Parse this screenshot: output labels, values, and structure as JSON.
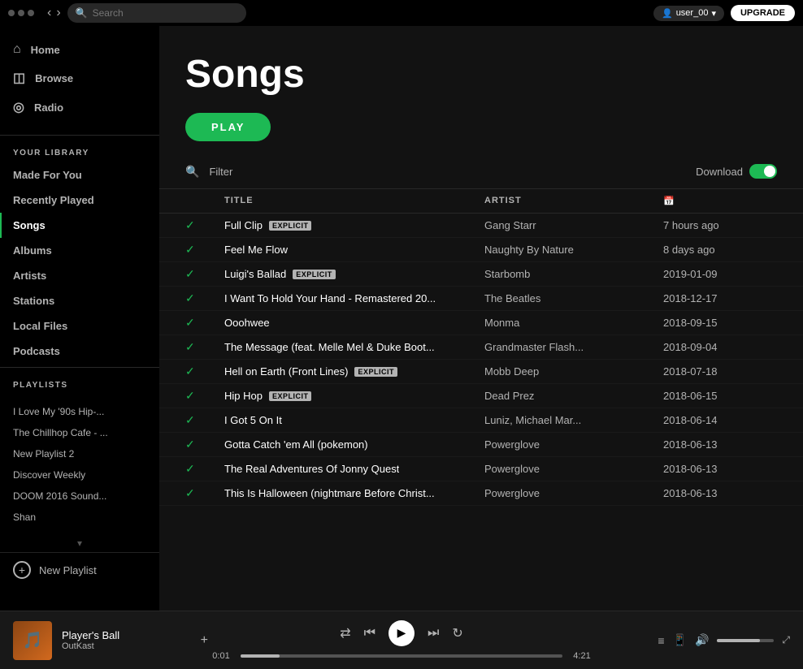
{
  "topbar": {
    "search_placeholder": "Search",
    "username": "user_00",
    "upgrade_label": "UPGRADE"
  },
  "sidebar": {
    "nav_items": [
      {
        "id": "home",
        "label": "Home",
        "icon": "⌂"
      },
      {
        "id": "browse",
        "label": "Browse",
        "icon": "◫"
      },
      {
        "id": "radio",
        "label": "Radio",
        "icon": "◎"
      }
    ],
    "library_title": "YOUR LIBRARY",
    "library_items": [
      {
        "id": "made-for-you",
        "label": "Made For You"
      },
      {
        "id": "recently-played",
        "label": "Recently Played"
      },
      {
        "id": "songs",
        "label": "Songs",
        "active": true
      },
      {
        "id": "albums",
        "label": "Albums"
      },
      {
        "id": "artists",
        "label": "Artists"
      },
      {
        "id": "stations",
        "label": "Stations"
      },
      {
        "id": "local-files",
        "label": "Local Files"
      },
      {
        "id": "podcasts",
        "label": "Podcasts"
      }
    ],
    "playlists_title": "PLAYLISTS",
    "playlists": [
      "I Love My '90s Hip-...",
      "The Chillhop Cafe - ...",
      "New Playlist 2",
      "Discover Weekly",
      "DOOM 2016 Sound...",
      "Shan"
    ],
    "new_playlist_label": "New Playlist"
  },
  "page": {
    "title": "Songs",
    "play_label": "PLAY",
    "filter_placeholder": "Filter",
    "download_label": "Download",
    "table_headers": {
      "title": "TITLE",
      "artist": "ARTIST",
      "date": "📅"
    },
    "songs": [
      {
        "title": "Full Clip",
        "explicit": true,
        "artist": "Gang Starr",
        "date": "7 hours ago"
      },
      {
        "title": "Feel Me Flow",
        "explicit": false,
        "artist": "Naughty By Nature",
        "date": "8 days ago"
      },
      {
        "title": "Luigi's Ballad",
        "explicit": true,
        "artist": "Starbomb",
        "date": "2019-01-09"
      },
      {
        "title": "I Want To Hold Your Hand - Remastered 20...",
        "explicit": false,
        "artist": "The Beatles",
        "date": "2018-12-17"
      },
      {
        "title": "Ooohwee",
        "explicit": false,
        "artist": "Monma",
        "date": "2018-09-15"
      },
      {
        "title": "The Message (feat. Melle Mel & Duke Boot...",
        "explicit": false,
        "artist": "Grandmaster Flash...",
        "date": "2018-09-04"
      },
      {
        "title": "Hell on Earth (Front Lines)",
        "explicit": true,
        "artist": "Mobb Deep",
        "date": "2018-07-18"
      },
      {
        "title": "Hip Hop",
        "explicit": true,
        "artist": "Dead Prez",
        "date": "2018-06-15"
      },
      {
        "title": "I Got 5 On It",
        "explicit": false,
        "artist": "Luniz, Michael Mar...",
        "date": "2018-06-14"
      },
      {
        "title": "Gotta Catch 'em All (pokemon)",
        "explicit": false,
        "artist": "Powerglove",
        "date": "2018-06-13"
      },
      {
        "title": "The Real Adventures Of Jonny Quest",
        "explicit": false,
        "artist": "Powerglove",
        "date": "2018-06-13"
      },
      {
        "title": "This Is Halloween (nightmare Before Christ...",
        "explicit": false,
        "artist": "Powerglove",
        "date": "2018-06-13"
      }
    ]
  },
  "player": {
    "track_name": "Player's Ball",
    "artist": "OutKast",
    "current_time": "0:01",
    "total_time": "4:21",
    "progress_percent": 12
  }
}
